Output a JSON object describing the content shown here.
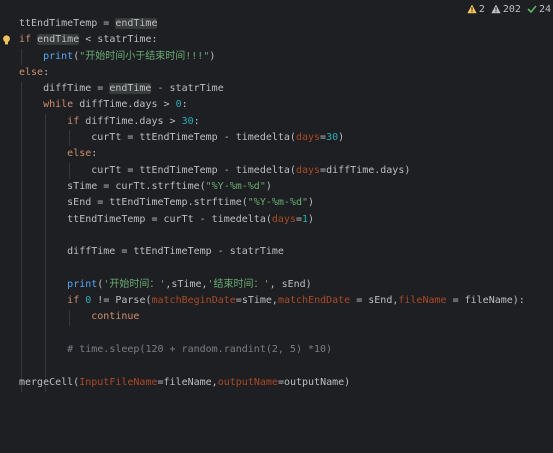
{
  "status": {
    "warnings": "2",
    "weak_warnings": "202",
    "typos": "24"
  },
  "code": {
    "lines": [
      "ttEndTimeTemp = endTime",
      "if endTime < statrTime:",
      "    print(\"开始时间小于结束时间!!!\")",
      "else:",
      "    diffTime = endTime - statrTime",
      "    while diffTime.days > 0:",
      "        if diffTime.days > 30:",
      "            curTt = ttEndTimeTemp - timedelta(days=30)",
      "        else:",
      "            curTt = ttEndTimeTemp - timedelta(days=diffTime.days)",
      "        sTime = curTt.strftime(\"%Y-%m-%d\")",
      "        sEnd = ttEndTimeTemp.strftime(\"%Y-%m-%d\")",
      "        ttEndTimeTemp = curTt - timedelta(days=1)",
      "",
      "        diffTime = ttEndTimeTemp - statrTime",
      "",
      "        print('开始时间：',sTime,'结束时间：', sEnd)",
      "        if 0 != Parse(matchBeginDate=sTime,matchEndDate = sEnd,fileName = fileName):",
      "            continue",
      "",
      "        # time.sleep(120 + random.randint(2, 5) *10)",
      "",
      "mergeCell(InputFileName=fileName,outputName=outputName)"
    ]
  },
  "colors": {
    "background": "#1e1f22",
    "keyword": "#cf8e6d",
    "string": "#6aab73",
    "number": "#2aacb8",
    "named_param": "#aa4926",
    "comment": "#7a7e85",
    "text": "#bcbec4"
  },
  "icons": [
    "warning-icon",
    "weak-warning-icon",
    "typo-check-icon",
    "intention-bulb-icon"
  ]
}
